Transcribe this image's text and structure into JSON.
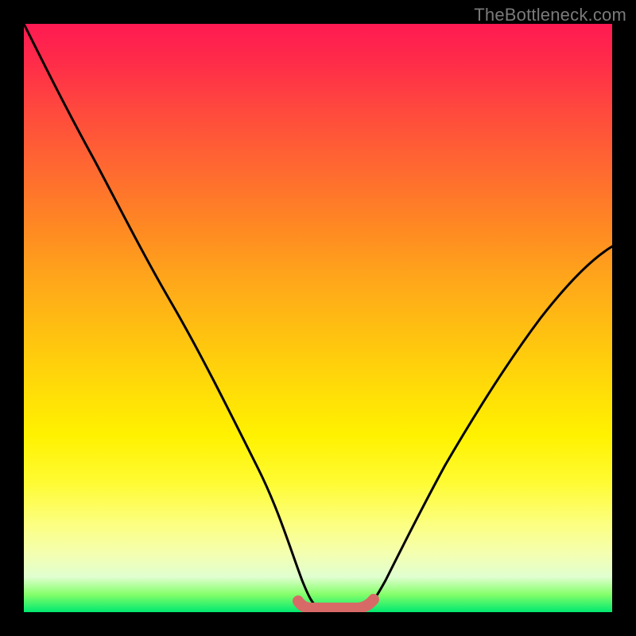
{
  "watermark": {
    "text": "TheBottleneck.com"
  },
  "colors": {
    "background": "#000000",
    "curve_line": "#000000",
    "bottom_marker": "#d76a67",
    "gradient_stops": [
      "#ff1a52",
      "#ff2a4a",
      "#ff4a3d",
      "#ff6a30",
      "#ff8a22",
      "#ffa81a",
      "#ffc210",
      "#ffdc08",
      "#fff200",
      "#fffb33",
      "#fcff80",
      "#f4ffb0",
      "#e0ffd0",
      "#84ff6a",
      "#00e870"
    ]
  },
  "chart_data": {
    "type": "line",
    "title": "",
    "xlabel": "",
    "ylabel": "",
    "xlim": [
      0,
      100
    ],
    "ylim": [
      0,
      100
    ],
    "series": [
      {
        "name": "bottleneck-curve",
        "x": [
          0,
          6,
          12,
          18,
          24,
          30,
          36,
          42,
          46,
          49,
          52,
          55,
          58,
          60,
          64,
          70,
          78,
          86,
          94,
          100
        ],
        "values": [
          100,
          88,
          76,
          64,
          52,
          40,
          28,
          16,
          6,
          1,
          0,
          0,
          1,
          3,
          10,
          20,
          32,
          44,
          54,
          62
        ]
      },
      {
        "name": "sweet-spot-marker",
        "x": [
          46,
          49,
          52,
          55,
          58
        ],
        "values": [
          2,
          1,
          1,
          1,
          2
        ]
      }
    ],
    "annotations": []
  }
}
